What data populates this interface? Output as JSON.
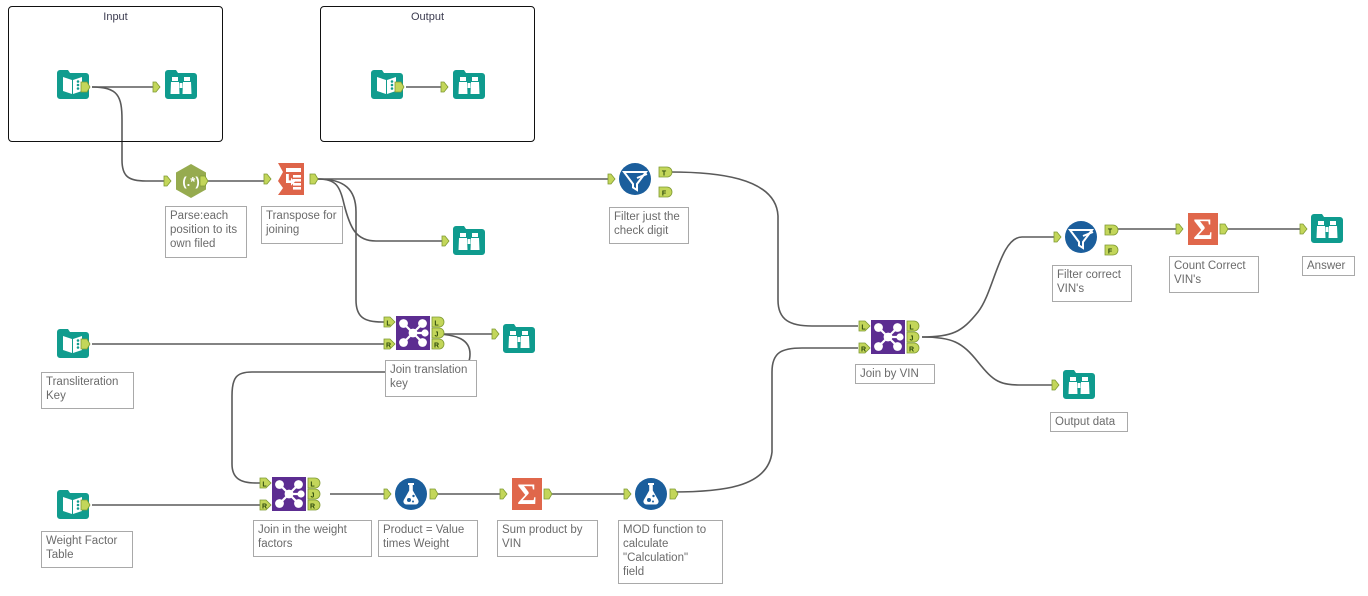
{
  "app": {
    "title": "Alteryx Workflow Canvas",
    "background_color": "#ffffff"
  },
  "palette": {
    "input_teal": "#119c8e",
    "browse_teal": "#0f9b8e",
    "regex_green": "#96ab4f",
    "transpose_salmon": "#de6449",
    "summarize_salmon": "#e0674b",
    "join_purple": "#5c2d91",
    "filter_blue": "#1b5e9c",
    "formula_blue": "#1b5e9c",
    "port_green": "#c3d65a",
    "wire_gray": "#5a5a5a",
    "label_text": "#6b6b6b",
    "label_border": "#a9a9a9",
    "container_border": "#111111"
  },
  "containers": [
    {
      "id": "input-container",
      "title": "Input"
    },
    {
      "id": "output-container",
      "title": "Output"
    }
  ],
  "nodes": [
    {
      "id": "input-vin",
      "type": "input",
      "icon": "book-input-icon",
      "label": ""
    },
    {
      "id": "browse-input",
      "type": "browse",
      "icon": "binoculars-icon",
      "label": ""
    },
    {
      "id": "input-output-sample",
      "type": "input",
      "icon": "book-input-icon",
      "label": ""
    },
    {
      "id": "browse-output-sample",
      "type": "browse",
      "icon": "binoculars-icon",
      "label": ""
    },
    {
      "id": "regex-parse",
      "type": "regex",
      "icon": "regex-icon",
      "label": "Parse:each\nposition to its\nown filed"
    },
    {
      "id": "transpose",
      "type": "transpose",
      "icon": "transpose-icon",
      "label": "Transpose for\njoining"
    },
    {
      "id": "browse-transpose",
      "type": "browse",
      "icon": "binoculars-icon",
      "label": ""
    },
    {
      "id": "filter-check-digit",
      "type": "filter",
      "icon": "filter-icon",
      "label": "Filter just the\ncheck digit"
    },
    {
      "id": "input-translit-key",
      "type": "input",
      "icon": "book-input-icon",
      "label": "Transliteration\nKey"
    },
    {
      "id": "join-translation-key",
      "type": "join",
      "icon": "join-icon",
      "label": "Join translation\nkey"
    },
    {
      "id": "browse-join-translit",
      "type": "browse",
      "icon": "binoculars-icon",
      "label": ""
    },
    {
      "id": "input-weight-factor",
      "type": "input",
      "icon": "book-input-icon",
      "label": "Weight Factor\nTable"
    },
    {
      "id": "join-weight-factors",
      "type": "join",
      "icon": "join-icon",
      "label": "Join in the weight\nfactors"
    },
    {
      "id": "formula-product",
      "type": "formula",
      "icon": "flask-icon",
      "label": "Product = Value\ntimes Weight"
    },
    {
      "id": "summarize-sum",
      "type": "summarize",
      "icon": "sigma-icon",
      "label": "Sum product by\nVIN"
    },
    {
      "id": "formula-mod",
      "type": "formula",
      "icon": "flask-icon",
      "label": "MOD function to\ncalculate\n\"Calculation\"\nfield"
    },
    {
      "id": "join-by-vin",
      "type": "join",
      "icon": "join-icon",
      "label": "Join by VIN"
    },
    {
      "id": "filter-correct-vins",
      "type": "filter",
      "icon": "filter-icon",
      "label": "Filter correct\nVIN's"
    },
    {
      "id": "summarize-count",
      "type": "summarize",
      "icon": "sigma-icon",
      "label": "Count Correct\nVIN's"
    },
    {
      "id": "browse-answer",
      "type": "browse",
      "icon": "binoculars-icon",
      "label": "Answer"
    },
    {
      "id": "browse-output-data",
      "type": "browse",
      "icon": "binoculars-icon",
      "label": "Output data"
    }
  ],
  "port_labels": {
    "left_in": "L",
    "right_in": "R",
    "left_out": "L",
    "join_out": "J",
    "right_out": "R",
    "true_out": "T",
    "false_out": "F"
  },
  "icon_glyphs": {
    "regex": "(.*)",
    "sigma": "Σ"
  }
}
